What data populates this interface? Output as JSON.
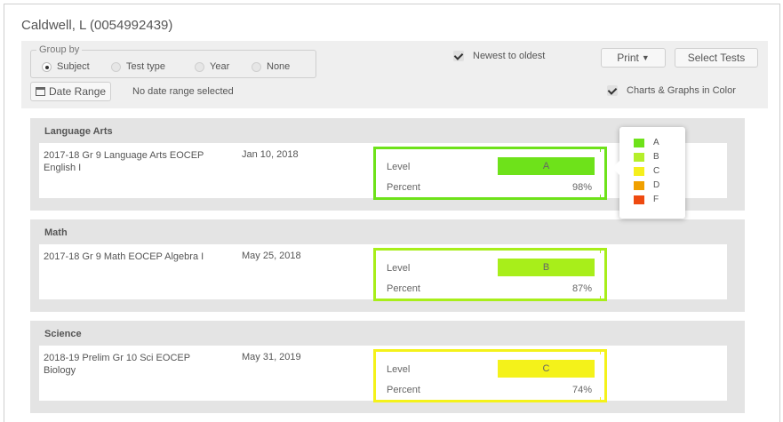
{
  "student": {
    "name": "Caldwell, L (0054992439)"
  },
  "toolbar": {
    "group_by": {
      "legend": "Group by",
      "options": [
        {
          "label": "Subject",
          "selected": true
        },
        {
          "label": "Test type",
          "selected": false
        },
        {
          "label": "Year",
          "selected": false
        },
        {
          "label": "None",
          "selected": false
        }
      ]
    },
    "newest_to_oldest": {
      "label": "Newest to oldest",
      "checked": true
    },
    "print_label": "Print",
    "select_tests_label": "Select Tests",
    "date_range": {
      "button_label": "Date Range",
      "status": "No date range selected"
    },
    "charts_color": {
      "label": "Charts & Graphs in Color",
      "checked": true
    }
  },
  "sections": [
    {
      "subject": "Language Arts",
      "tests": [
        {
          "name": "2017-18 Gr 9 Language Arts EOCEP English I",
          "date": "Jan 10, 2018",
          "level_label": "Level",
          "level": "A",
          "percent_label": "Percent",
          "percent": "98%",
          "color": "#6ee21a"
        }
      ]
    },
    {
      "subject": "Math",
      "tests": [
        {
          "name": "2017-18 Gr 9 Math EOCEP Algebra I",
          "date": "May 25, 2018",
          "level_label": "Level",
          "level": "B",
          "percent_label": "Percent",
          "percent": "87%",
          "color": "#a8ee1a"
        }
      ]
    },
    {
      "subject": "Science",
      "tests": [
        {
          "name": "2018-19 Prelim Gr 10 Sci EOCEP Biology",
          "date": "May 31, 2019",
          "level_label": "Level",
          "level": "C",
          "percent_label": "Percent",
          "percent": "74%",
          "color": "#f4f21a"
        }
      ]
    }
  ],
  "legend": {
    "items": [
      {
        "label": "A",
        "color": "#6ee21a"
      },
      {
        "label": "B",
        "color": "#b5ef2a"
      },
      {
        "label": "C",
        "color": "#f5ef1c"
      },
      {
        "label": "D",
        "color": "#f0a000"
      },
      {
        "label": "F",
        "color": "#ee4a10"
      }
    ]
  },
  "icons": {
    "calendar": "calendar-icon",
    "print_caret": "chevron-down-icon"
  }
}
